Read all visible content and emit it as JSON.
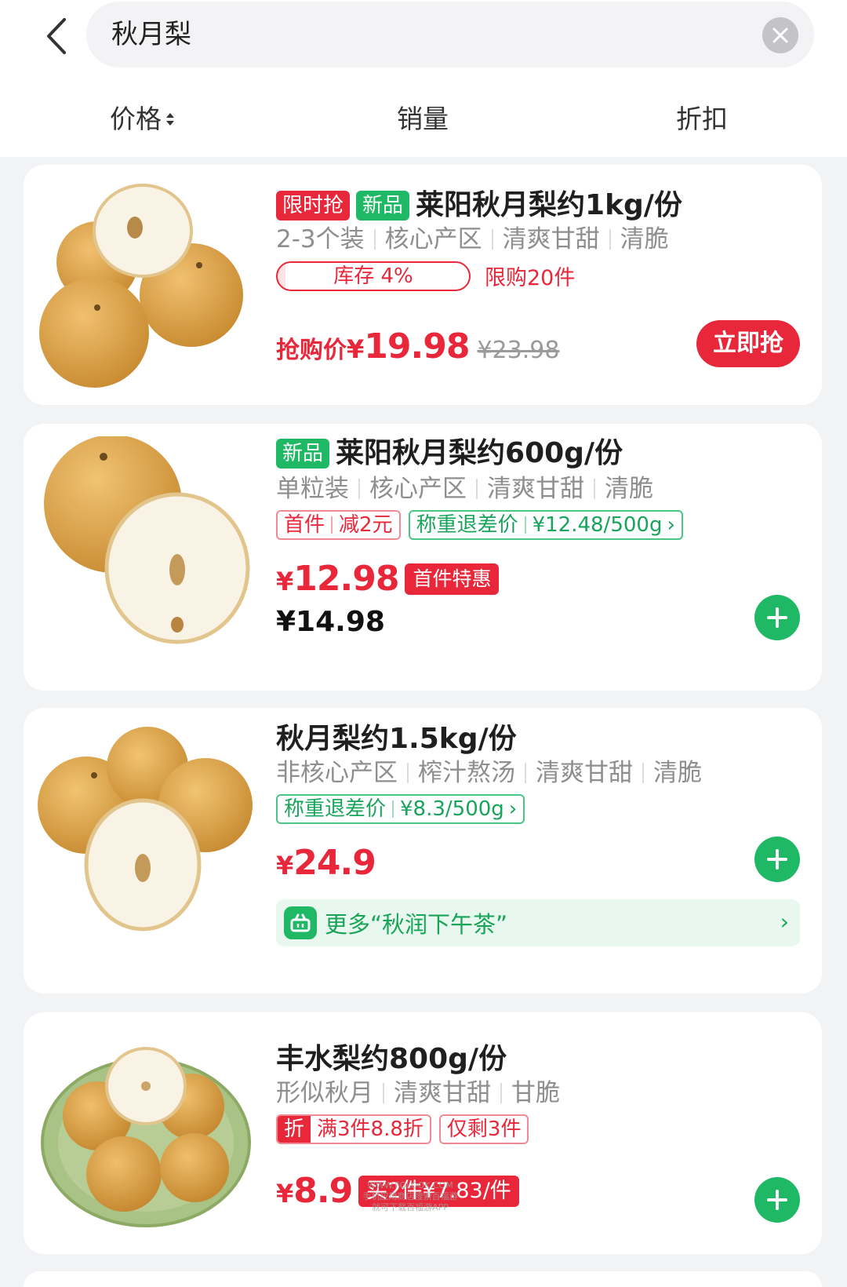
{
  "search": {
    "query": "秋月梨"
  },
  "sort": {
    "price": "价格",
    "sales": "销量",
    "discount": "折扣"
  },
  "products": [
    {
      "badges": [
        "限时抢",
        "新品"
      ],
      "title": "莱阳秋月梨约1kg/份",
      "subtitle": [
        "2-3个装",
        "核心产区",
        "清爽甘甜",
        "清脆"
      ],
      "stock": "库存 4%",
      "limit": "限购20件",
      "price_label": "抢购价",
      "currency": "¥",
      "price": "19.98",
      "original_price": "¥23.98",
      "button": "立即抢",
      "stock_fraction": 0.04
    },
    {
      "badges": [
        "新品"
      ],
      "title": "莱阳秋月梨约600g/份",
      "subtitle": [
        "单粒装",
        "核心产区",
        "清爽甘甜",
        "清脆"
      ],
      "tag_red": [
        "首件",
        "减2元"
      ],
      "tag_green": [
        "称重退差价",
        "¥12.48/500g"
      ],
      "currency": "¥",
      "price": "12.98",
      "price_tag": "首件特惠",
      "regular_price": "¥14.98"
    },
    {
      "title": "秋月梨约1.5kg/份",
      "subtitle": [
        "非核心产区",
        "榨汁熬汤",
        "清爽甘甜",
        "清脆"
      ],
      "tag_green": [
        "称重退差价",
        "¥8.3/500g"
      ],
      "currency": "¥",
      "price": "24.9",
      "more": "更多“秋润下午茶”"
    },
    {
      "title": "丰水梨约800g/份",
      "subtitle": [
        "形似秋月",
        "清爽甘甜",
        "甘脆"
      ],
      "tag_split": [
        "折",
        "满3件8.8折"
      ],
      "tag_red_single": "仅剩3件",
      "currency": "¥",
      "price": "8.9",
      "promo": "买2件¥7.83/件"
    }
  ],
  "watermark": {
    "brand": "百福游",
    "site": "WWW.FQLOOK.COM",
    "line1": "手机应用商店搜索百福游",
    "line2": "就可下载百福游APP"
  },
  "colors": {
    "accent_red": "#e8283a",
    "accent_green": "#1fb865",
    "pear": "#d9a14a"
  }
}
